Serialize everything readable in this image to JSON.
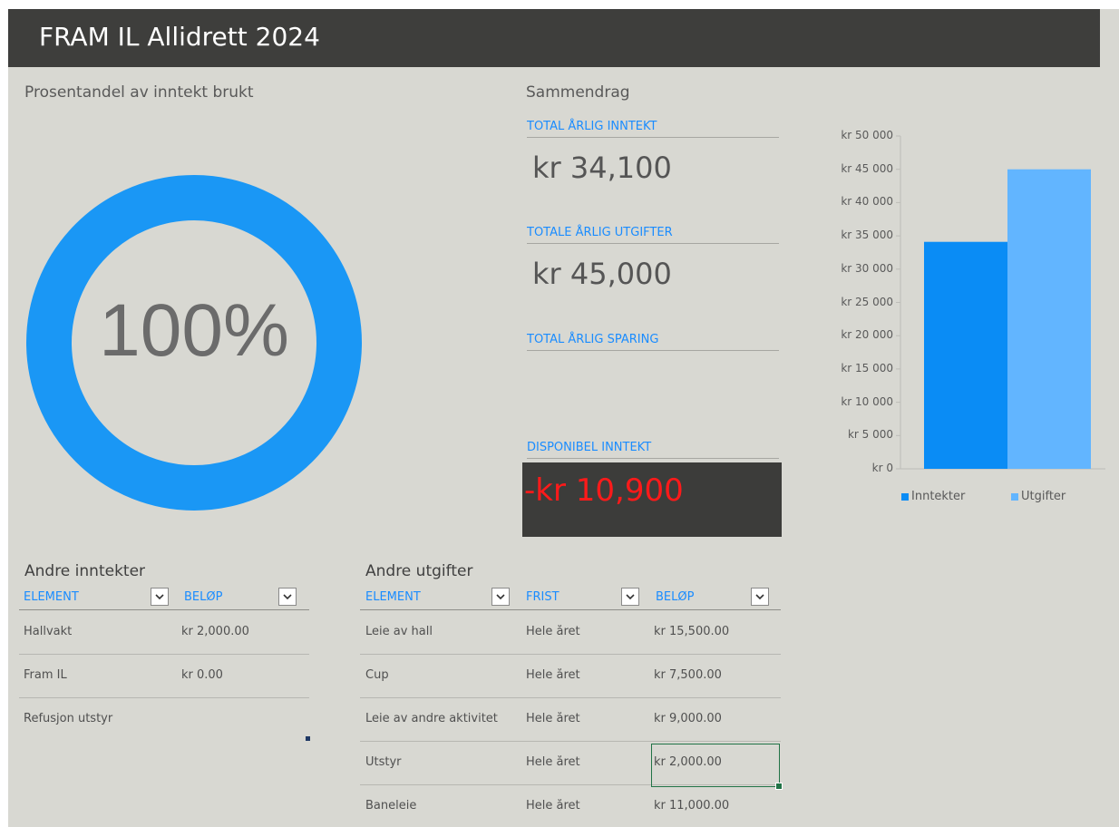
{
  "header": {
    "title": "FRAM IL Allidrett 2024"
  },
  "donut": {
    "title": "Prosentandel av inntekt brukt",
    "percent_label": "100%",
    "fraction_used": 1.0,
    "color": "#1a97f5"
  },
  "summary": {
    "title": "Sammendrag",
    "income_label": "TOTAL ÅRLIG INNTEKT",
    "income_value": "kr 34,100",
    "expense_label": "TOTALE ÅRLIG UTGIFTER",
    "expense_value": "kr 45,000",
    "savings_label": "TOTAL ÅRLIG SPARING",
    "disposable_label": "DISPONIBEL INNTEKT",
    "disposable_value": "-kr 10,900"
  },
  "chart_data": {
    "type": "bar",
    "categories": [
      ""
    ],
    "series": [
      {
        "name": "Inntekter",
        "values": [
          34100
        ],
        "color": "#0a8cf5"
      },
      {
        "name": "Utgifter",
        "values": [
          45000
        ],
        "color": "#62b5ff"
      }
    ],
    "ylim": [
      0,
      50000
    ],
    "yticks": [
      0,
      5000,
      10000,
      15000,
      20000,
      25000,
      30000,
      35000,
      40000,
      45000,
      50000
    ],
    "ytick_labels": [
      "kr 0",
      "kr 5 000",
      "kr 10 000",
      "kr 15 000",
      "kr 20 000",
      "kr 25 000",
      "kr 30 000",
      "kr 35 000",
      "kr 40 000",
      "kr 45 000",
      "kr 50 000"
    ],
    "legend_position": "bottom",
    "grid": false
  },
  "income_table": {
    "title": "Andre inntekter",
    "headers": [
      "ELEMENT",
      "BELØP"
    ],
    "rows": [
      [
        "Hallvakt",
        "kr 2,000.00"
      ],
      [
        "Fram IL",
        "kr 0.00"
      ],
      [
        "Refusjon utstyr",
        ""
      ]
    ]
  },
  "expense_table": {
    "title": "Andre utgifter",
    "headers": [
      "ELEMENT",
      "FRIST",
      "BELØP"
    ],
    "rows": [
      [
        "Leie av hall",
        "Hele året",
        "kr 15,500.00"
      ],
      [
        "Cup",
        "Hele året",
        "kr 7,500.00"
      ],
      [
        "Leie av andre aktivitet",
        "Hele året",
        "kr 9,000.00"
      ],
      [
        "Utstyr",
        "Hele året",
        "kr 2,000.00"
      ],
      [
        "Baneleie",
        "Hele året",
        "kr 11,000.00"
      ]
    ]
  }
}
